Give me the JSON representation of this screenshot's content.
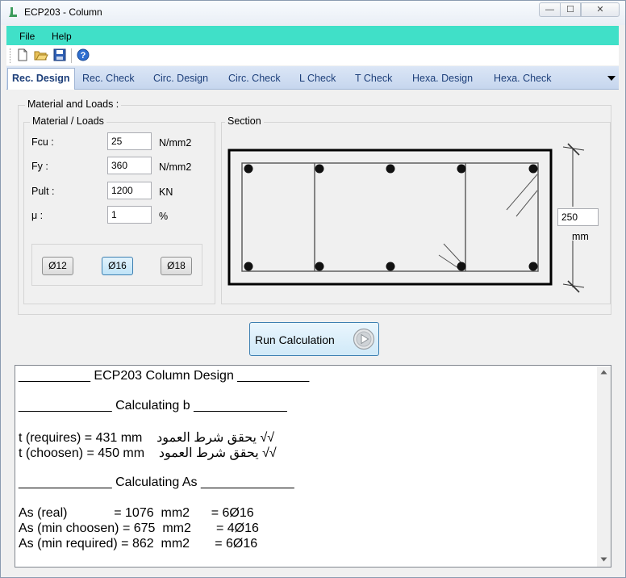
{
  "window": {
    "title": "ECP203 - Column",
    "min": "—",
    "max": "☐",
    "close": "✕"
  },
  "menu": {
    "items": [
      "File",
      "Help"
    ]
  },
  "toolbar": {
    "icons": [
      "new-icon",
      "open-icon",
      "save-icon",
      "help-icon"
    ]
  },
  "tabs": [
    "Rec. Design",
    "Rec. Check",
    "Circ. Design",
    "Circ. Check",
    "L Check",
    "T Check",
    "Hexa. Design",
    "Hexa. Check"
  ],
  "active_tab": "Rec. Design",
  "material": {
    "group_title": "Material and Loads :",
    "sub_title": "Material / Loads",
    "fields": [
      {
        "label": "Fcu :",
        "value": "25",
        "unit": "N/mm2"
      },
      {
        "label": "Fy :",
        "value": "360",
        "unit": "N/mm2"
      },
      {
        "label": "Pult :",
        "value": "1200",
        "unit": "KN"
      },
      {
        "label": "μ :",
        "value": "1",
        "unit": "%"
      }
    ],
    "diameters": [
      "Ø12",
      "Ø16",
      "Ø18"
    ],
    "selected_diameter": "Ø16"
  },
  "section": {
    "title": "Section",
    "dimension_value": "250",
    "dimension_unit": "mm"
  },
  "run_button": {
    "label": "Run Calculation"
  },
  "output": {
    "lines": [
      "__________ ECP203 Column Design __________",
      "",
      "_____________ Calculating b _____________",
      "",
      "t (requires) = 431 mm    يحقق شرط العمود √√",
      "t (choosen) = 450 mm    يحقق شرط العمود √√",
      "",
      "_____________ Calculating As _____________",
      "",
      "As (real)             = 1076  mm2      = 6Ø16",
      "As (min choosen) = 675  mm2       = 4Ø16",
      "As (min required) = 862  mm2       = 6Ø16"
    ]
  },
  "colors": {
    "menubar": "#40e0c8",
    "tab_text": "#1d3f7a"
  }
}
